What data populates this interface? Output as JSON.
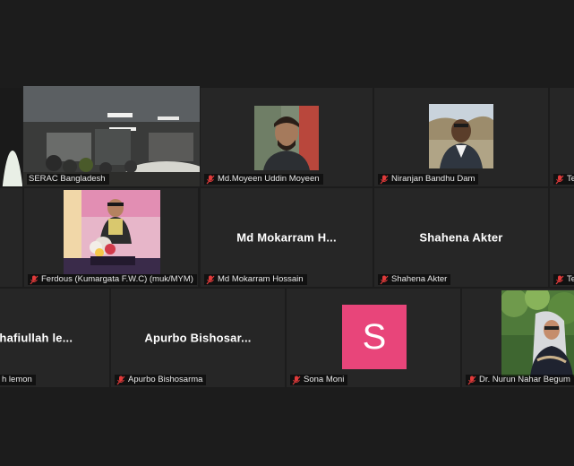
{
  "tiles": {
    "serac": {
      "name": "SERAC Bangladesh"
    },
    "moyeen": {
      "name": "Md.Moyeen Uddin Moyeen"
    },
    "niranjan": {
      "name": "Niranjan Bandhu Dam"
    },
    "edge_right_1": {
      "name": "Te"
    },
    "ferdous": {
      "name": "Ferdous (Kumargata F.W.C) (muk/MYM)"
    },
    "mokarram": {
      "display": "Md  Mokarram  H...",
      "name": "Md Mokarram Hossain"
    },
    "shahena": {
      "display": "Shahena Akter",
      "name": "Shahena Akter"
    },
    "edge_right_2": {
      "name": "Te"
    },
    "shafiullah": {
      "display": "shafiullah  le...",
      "name": "h lemon"
    },
    "apurbo": {
      "display": "Apurbo  Bishosar...",
      "name": "Apurbo Bishosarma"
    },
    "sona": {
      "avatar_letter": "S",
      "name": "Sona Moni"
    },
    "nurun": {
      "name": "Dr. Nurun Nahar Begum"
    }
  },
  "colors": {
    "active_border": "#c8e66e",
    "avatar_pink": "#e8457a",
    "mic_off": "#e03a3a"
  },
  "icons": {
    "muted": "mic-muted-icon"
  }
}
